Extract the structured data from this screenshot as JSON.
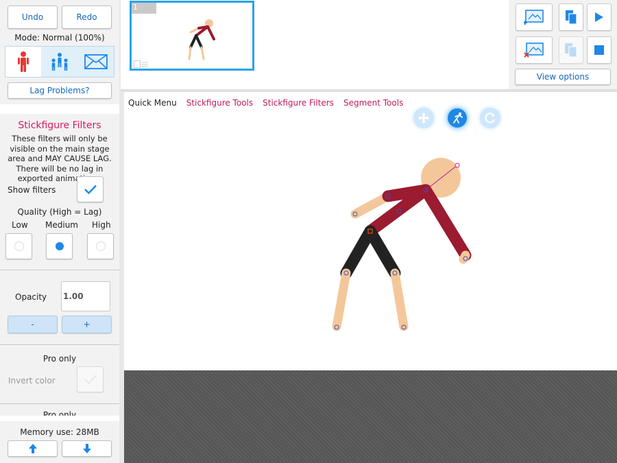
{
  "history": {
    "undo_label": "Undo",
    "redo_label": "Redo"
  },
  "mode_text": "Mode: Normal (100%)",
  "mode_icons": [
    "stickfigure-icon",
    "group-icon",
    "envelope-icon"
  ],
  "lag_button": "Lag Problems?",
  "filters": {
    "title": "Stickfigure Filters",
    "description": "These filters will only be visible on the main stage area and MAY CAUSE LAG. There will be no lag in exported animations.",
    "show_filters_label": "Show filters",
    "show_filters_checked": true,
    "quality_label": "Quality (High = Lag)",
    "quality_options": [
      "Low",
      "Medium",
      "High"
    ],
    "quality_selected": "Medium"
  },
  "opacity": {
    "label": "Opacity",
    "value": "1.00",
    "minus": "-",
    "plus": "+"
  },
  "pro": {
    "title": "Pro only",
    "invert_label": "Invert color",
    "next_title": "Pro only"
  },
  "memory": {
    "label": "Memory use: 28MB"
  },
  "timeline": {
    "frame_number": "1"
  },
  "tools": {
    "view_options": "View options"
  },
  "quick_menu": {
    "label": "Quick Menu",
    "items": [
      "Stickfigure Tools",
      "Stickfigure Filters",
      "Segment Tools"
    ]
  },
  "colors": {
    "accent": "#1e88e5",
    "pink": "#c2185b",
    "body_red": "#9b1b30",
    "legs_dark": "#222222",
    "skin": "#f4c79a"
  }
}
